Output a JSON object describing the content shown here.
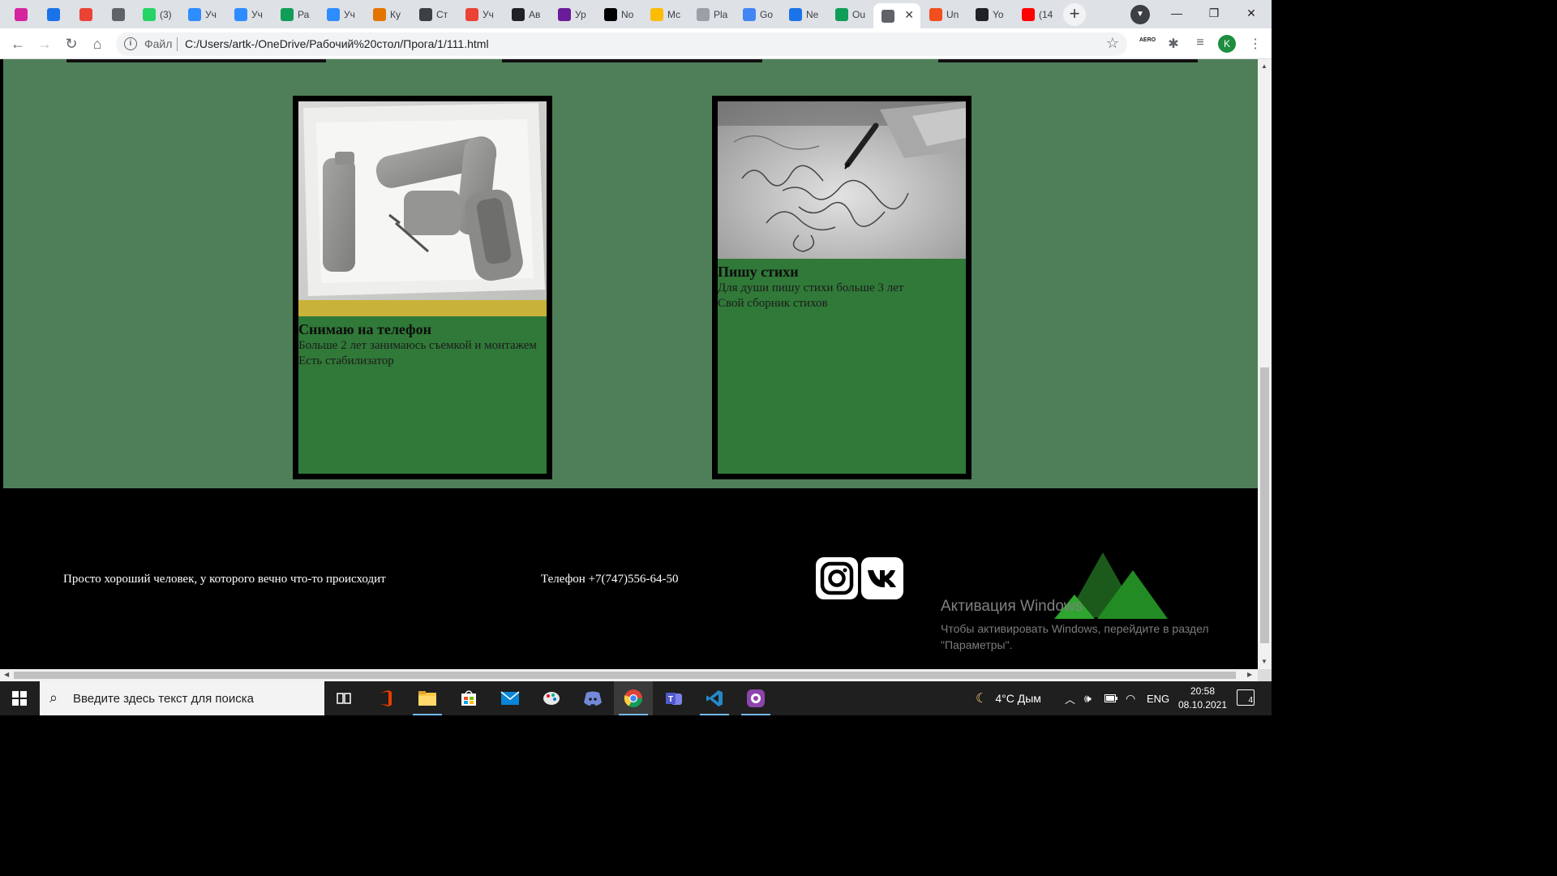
{
  "browser": {
    "tabs": [
      {
        "icon": "instagram-icon",
        "label": "",
        "color": "#d6249f"
      },
      {
        "icon": "messages-icon",
        "label": "",
        "color": "#1a73e8"
      },
      {
        "icon": "gmail-icon",
        "label": "",
        "color": "#ea4335"
      },
      {
        "icon": "record-icon",
        "label": "",
        "color": "#5f6368"
      },
      {
        "icon": "whatsapp-icon",
        "label": "(3)",
        "color": "#25d366"
      },
      {
        "icon": "zoom-icon",
        "label": "Уч",
        "color": "#2d8cff"
      },
      {
        "icon": "zoom-icon",
        "label": "Уч",
        "color": "#2d8cff"
      },
      {
        "icon": "sheets-icon",
        "label": "Ра",
        "color": "#0f9d58"
      },
      {
        "icon": "zoom-icon",
        "label": "Уч",
        "color": "#2d8cff"
      },
      {
        "icon": "course-icon",
        "label": "Ку",
        "color": "#e37400"
      },
      {
        "icon": "gc-icon",
        "label": "Ст",
        "color": "#3c4043"
      },
      {
        "icon": "gmail-icon",
        "label": "Уч",
        "color": "#ea4335"
      },
      {
        "icon": "n-icon",
        "label": "Ав",
        "color": "#202124"
      },
      {
        "icon": "circle-icon",
        "label": "Ур",
        "color": "#6a1b9a"
      },
      {
        "icon": "notion-icon",
        "label": "No",
        "color": "#000000"
      },
      {
        "icon": "drive-icon",
        "label": "Мс",
        "color": "#fbbc04"
      },
      {
        "icon": "page-icon",
        "label": "Pla",
        "color": "#9aa0a6"
      },
      {
        "icon": "translate-icon",
        "label": "Go",
        "color": "#4285f4"
      },
      {
        "icon": "link-icon",
        "label": "Ne",
        "color": "#1a73e8"
      },
      {
        "icon": "sheets-icon",
        "label": "Ou",
        "color": "#0f9d58"
      },
      {
        "icon": "globe-icon",
        "label": "",
        "color": "#5f6368",
        "active": true
      },
      {
        "icon": "figma-icon",
        "label": "Un",
        "color": "#f24e1e"
      },
      {
        "icon": "github-icon",
        "label": "Yo",
        "color": "#202124"
      },
      {
        "icon": "youtube-icon",
        "label": "(14",
        "color": "#ff0000"
      }
    ],
    "address": {
      "scheme_label": "Файл",
      "url": "C:/Users/artk-/OneDrive/Рабочий%20стол/Прога/1/111.html"
    },
    "profile_initial": "K",
    "ext_aero_label": "AERO"
  },
  "page": {
    "colors": {
      "background": "#4f7f59",
      "card": "#307938",
      "footer": "#000000"
    },
    "cards": [
      {
        "title": "Снимаю на телефон",
        "lines": [
          "Больше 2 лет занимаюсь съемкой и монтажем",
          "Есть стабилизатор"
        ],
        "image": "gimbal-stabilizer-photo"
      },
      {
        "title": "Пишу стихи",
        "lines": [
          "Для души пишу стихи больше 3 лет",
          "Свой сборник стихов"
        ],
        "image": "handwriting-photo"
      }
    ],
    "footer": {
      "about": "Просто хороший человек, у которого вечно что-то происходит",
      "phone": "Телефон +7(747)556-64-50",
      "socials": [
        "instagram-icon",
        "vk-icon"
      ]
    }
  },
  "watermark": {
    "title": "Активация Windows",
    "subtitle": "Чтобы активировать Windows, перейдите в раздел \"Параметры\"."
  },
  "taskbar": {
    "search_placeholder": "Введите здесь текст для поиска",
    "apps": [
      "task-view-icon",
      "office-icon",
      "file-explorer-icon",
      "store-icon",
      "mail-icon",
      "paint-icon",
      "discord-icon",
      "chrome-icon",
      "teams-icon",
      "vscode-icon",
      "github-desktop-icon"
    ],
    "weather": "4°C Дым",
    "language": "ENG",
    "time": "20:58",
    "date": "08.10.2021",
    "notifications": "4"
  }
}
